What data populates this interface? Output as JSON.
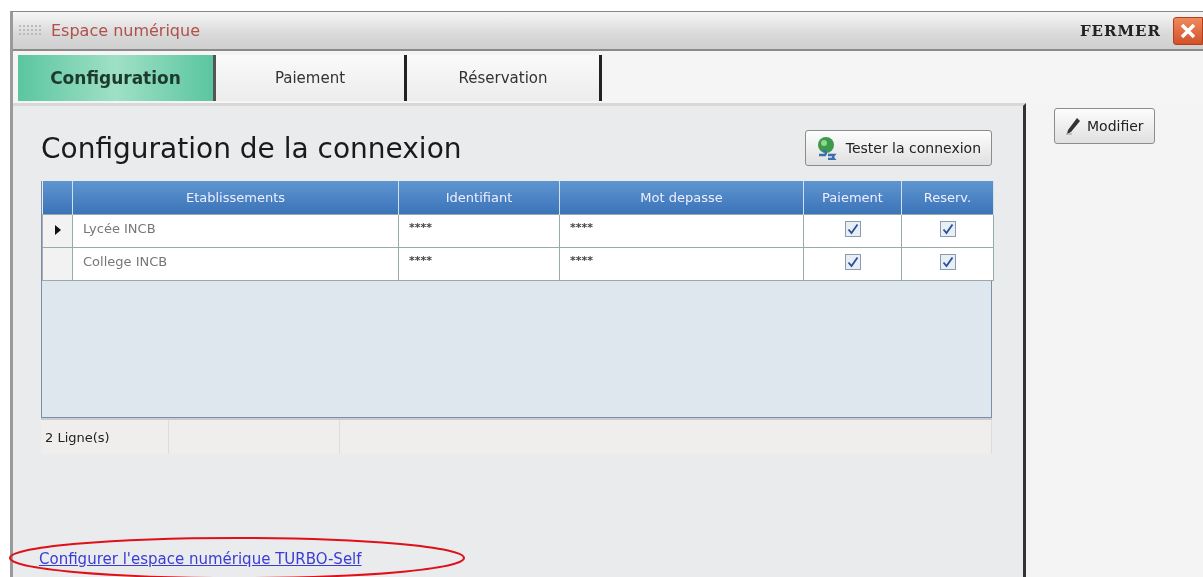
{
  "window": {
    "title": "Espace numérique",
    "close_label": "FERMER"
  },
  "tabs": [
    {
      "label": "Configuration",
      "selected": true
    },
    {
      "label": "Paiement",
      "selected": false
    },
    {
      "label": "Réservation",
      "selected": false
    }
  ],
  "heading": "Configuration de la connexion",
  "test_button": "Tester la connexion",
  "modify_button": "Modifier",
  "table": {
    "columns": [
      "Etablissements",
      "Identifiant",
      "Mot depasse",
      "Paiement",
      "Reserv."
    ],
    "rows": [
      {
        "selected": true,
        "establishment": "Lycée INCB",
        "identifier": "****",
        "password": "****",
        "payment": true,
        "reservation": true
      },
      {
        "selected": false,
        "establishment": "College INCB",
        "identifier": "****",
        "password": "****",
        "payment": true,
        "reservation": true
      }
    ],
    "footer": "2 Ligne(s)"
  },
  "link": "Configurer l'espace numérique TURBO-Self"
}
